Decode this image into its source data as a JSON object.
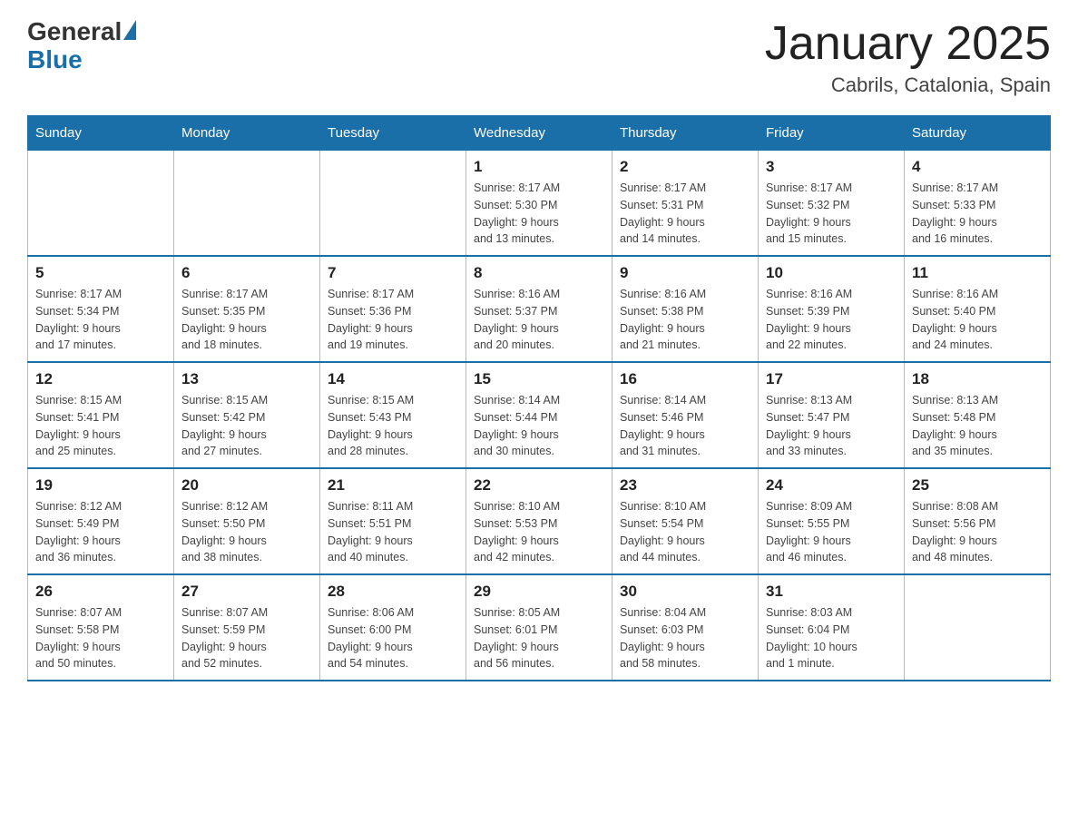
{
  "logo": {
    "general": "General",
    "blue": "Blue"
  },
  "title": "January 2025",
  "subtitle": "Cabrils, Catalonia, Spain",
  "days_of_week": [
    "Sunday",
    "Monday",
    "Tuesday",
    "Wednesday",
    "Thursday",
    "Friday",
    "Saturday"
  ],
  "weeks": [
    [
      {
        "day": "",
        "info": ""
      },
      {
        "day": "",
        "info": ""
      },
      {
        "day": "",
        "info": ""
      },
      {
        "day": "1",
        "info": "Sunrise: 8:17 AM\nSunset: 5:30 PM\nDaylight: 9 hours\nand 13 minutes."
      },
      {
        "day": "2",
        "info": "Sunrise: 8:17 AM\nSunset: 5:31 PM\nDaylight: 9 hours\nand 14 minutes."
      },
      {
        "day": "3",
        "info": "Sunrise: 8:17 AM\nSunset: 5:32 PM\nDaylight: 9 hours\nand 15 minutes."
      },
      {
        "day": "4",
        "info": "Sunrise: 8:17 AM\nSunset: 5:33 PM\nDaylight: 9 hours\nand 16 minutes."
      }
    ],
    [
      {
        "day": "5",
        "info": "Sunrise: 8:17 AM\nSunset: 5:34 PM\nDaylight: 9 hours\nand 17 minutes."
      },
      {
        "day": "6",
        "info": "Sunrise: 8:17 AM\nSunset: 5:35 PM\nDaylight: 9 hours\nand 18 minutes."
      },
      {
        "day": "7",
        "info": "Sunrise: 8:17 AM\nSunset: 5:36 PM\nDaylight: 9 hours\nand 19 minutes."
      },
      {
        "day": "8",
        "info": "Sunrise: 8:16 AM\nSunset: 5:37 PM\nDaylight: 9 hours\nand 20 minutes."
      },
      {
        "day": "9",
        "info": "Sunrise: 8:16 AM\nSunset: 5:38 PM\nDaylight: 9 hours\nand 21 minutes."
      },
      {
        "day": "10",
        "info": "Sunrise: 8:16 AM\nSunset: 5:39 PM\nDaylight: 9 hours\nand 22 minutes."
      },
      {
        "day": "11",
        "info": "Sunrise: 8:16 AM\nSunset: 5:40 PM\nDaylight: 9 hours\nand 24 minutes."
      }
    ],
    [
      {
        "day": "12",
        "info": "Sunrise: 8:15 AM\nSunset: 5:41 PM\nDaylight: 9 hours\nand 25 minutes."
      },
      {
        "day": "13",
        "info": "Sunrise: 8:15 AM\nSunset: 5:42 PM\nDaylight: 9 hours\nand 27 minutes."
      },
      {
        "day": "14",
        "info": "Sunrise: 8:15 AM\nSunset: 5:43 PM\nDaylight: 9 hours\nand 28 minutes."
      },
      {
        "day": "15",
        "info": "Sunrise: 8:14 AM\nSunset: 5:44 PM\nDaylight: 9 hours\nand 30 minutes."
      },
      {
        "day": "16",
        "info": "Sunrise: 8:14 AM\nSunset: 5:46 PM\nDaylight: 9 hours\nand 31 minutes."
      },
      {
        "day": "17",
        "info": "Sunrise: 8:13 AM\nSunset: 5:47 PM\nDaylight: 9 hours\nand 33 minutes."
      },
      {
        "day": "18",
        "info": "Sunrise: 8:13 AM\nSunset: 5:48 PM\nDaylight: 9 hours\nand 35 minutes."
      }
    ],
    [
      {
        "day": "19",
        "info": "Sunrise: 8:12 AM\nSunset: 5:49 PM\nDaylight: 9 hours\nand 36 minutes."
      },
      {
        "day": "20",
        "info": "Sunrise: 8:12 AM\nSunset: 5:50 PM\nDaylight: 9 hours\nand 38 minutes."
      },
      {
        "day": "21",
        "info": "Sunrise: 8:11 AM\nSunset: 5:51 PM\nDaylight: 9 hours\nand 40 minutes."
      },
      {
        "day": "22",
        "info": "Sunrise: 8:10 AM\nSunset: 5:53 PM\nDaylight: 9 hours\nand 42 minutes."
      },
      {
        "day": "23",
        "info": "Sunrise: 8:10 AM\nSunset: 5:54 PM\nDaylight: 9 hours\nand 44 minutes."
      },
      {
        "day": "24",
        "info": "Sunrise: 8:09 AM\nSunset: 5:55 PM\nDaylight: 9 hours\nand 46 minutes."
      },
      {
        "day": "25",
        "info": "Sunrise: 8:08 AM\nSunset: 5:56 PM\nDaylight: 9 hours\nand 48 minutes."
      }
    ],
    [
      {
        "day": "26",
        "info": "Sunrise: 8:07 AM\nSunset: 5:58 PM\nDaylight: 9 hours\nand 50 minutes."
      },
      {
        "day": "27",
        "info": "Sunrise: 8:07 AM\nSunset: 5:59 PM\nDaylight: 9 hours\nand 52 minutes."
      },
      {
        "day": "28",
        "info": "Sunrise: 8:06 AM\nSunset: 6:00 PM\nDaylight: 9 hours\nand 54 minutes."
      },
      {
        "day": "29",
        "info": "Sunrise: 8:05 AM\nSunset: 6:01 PM\nDaylight: 9 hours\nand 56 minutes."
      },
      {
        "day": "30",
        "info": "Sunrise: 8:04 AM\nSunset: 6:03 PM\nDaylight: 9 hours\nand 58 minutes."
      },
      {
        "day": "31",
        "info": "Sunrise: 8:03 AM\nSunset: 6:04 PM\nDaylight: 10 hours\nand 1 minute."
      },
      {
        "day": "",
        "info": ""
      }
    ]
  ]
}
